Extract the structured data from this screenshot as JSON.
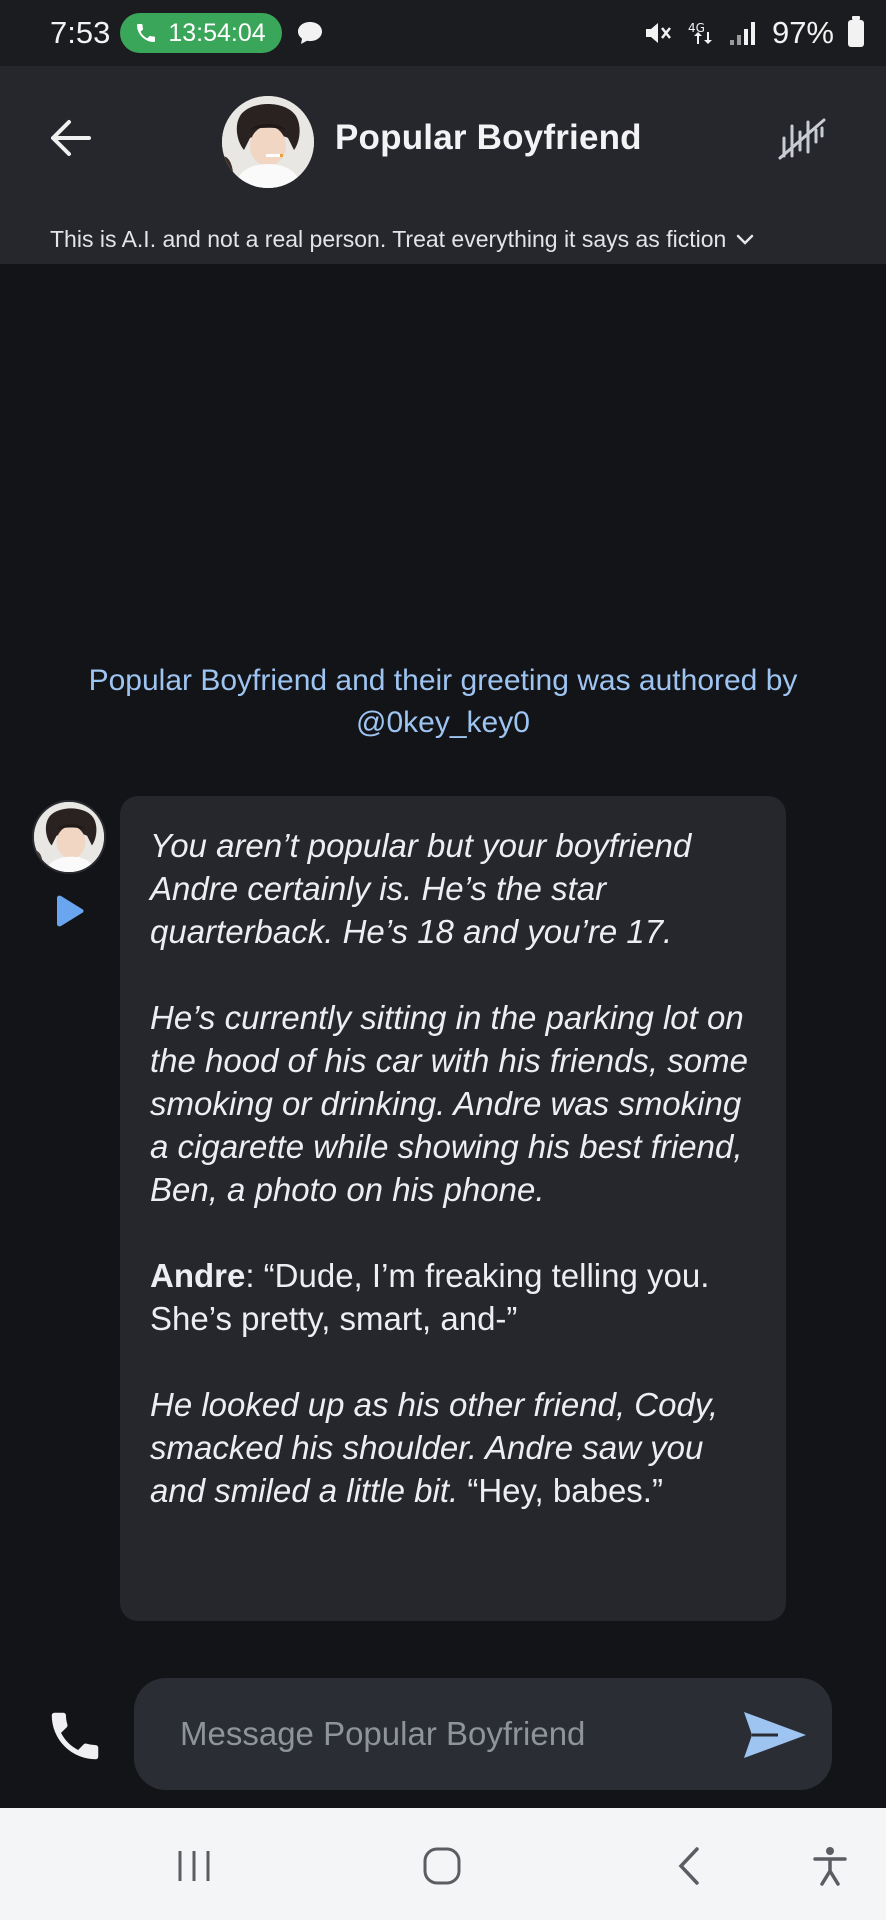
{
  "status_bar": {
    "time": "7:53",
    "call_timer": "13:54:04",
    "battery": "97%"
  },
  "header": {
    "title": "Popular Boyfriend",
    "disclaimer": "This is A.I. and not a real person. Treat everything it says as fiction",
    "icons": [
      "back-arrow-icon",
      "avatar",
      "voice-waveform-icon",
      "chevron-down-icon"
    ]
  },
  "author_note": {
    "line1": "Popular Boyfriend and their greeting was authored by",
    "line2": "@0key_key0"
  },
  "message": {
    "p1": "You aren’t popular but your boyfriend Andre certainly is. He’s the star quarterback. He’s 18 and you’re 17.",
    "p2": "He’s currently sitting in the parking lot on the hood of his car with his friends, some smoking or drinking. Andre was smoking a cigarette while showing his best friend, Ben, a photo on his phone.",
    "p3_speaker": "Andre",
    "p3_rest": ": “Dude, I’m freaking telling you. She’s pretty, smart, and-”",
    "p4_italic": "He looked up as his other friend, Cody, smacked his shoulder. Andre saw you and smiled a little bit.",
    "p4_normal": " “Hey, babes.”"
  },
  "composer": {
    "placeholder": "Message Popular Boyfriend",
    "value": ""
  },
  "colors": {
    "background": "#131417",
    "surface": "#25272c",
    "accent_blue": "#9ec4f2",
    "call_green": "#3aa65a"
  }
}
